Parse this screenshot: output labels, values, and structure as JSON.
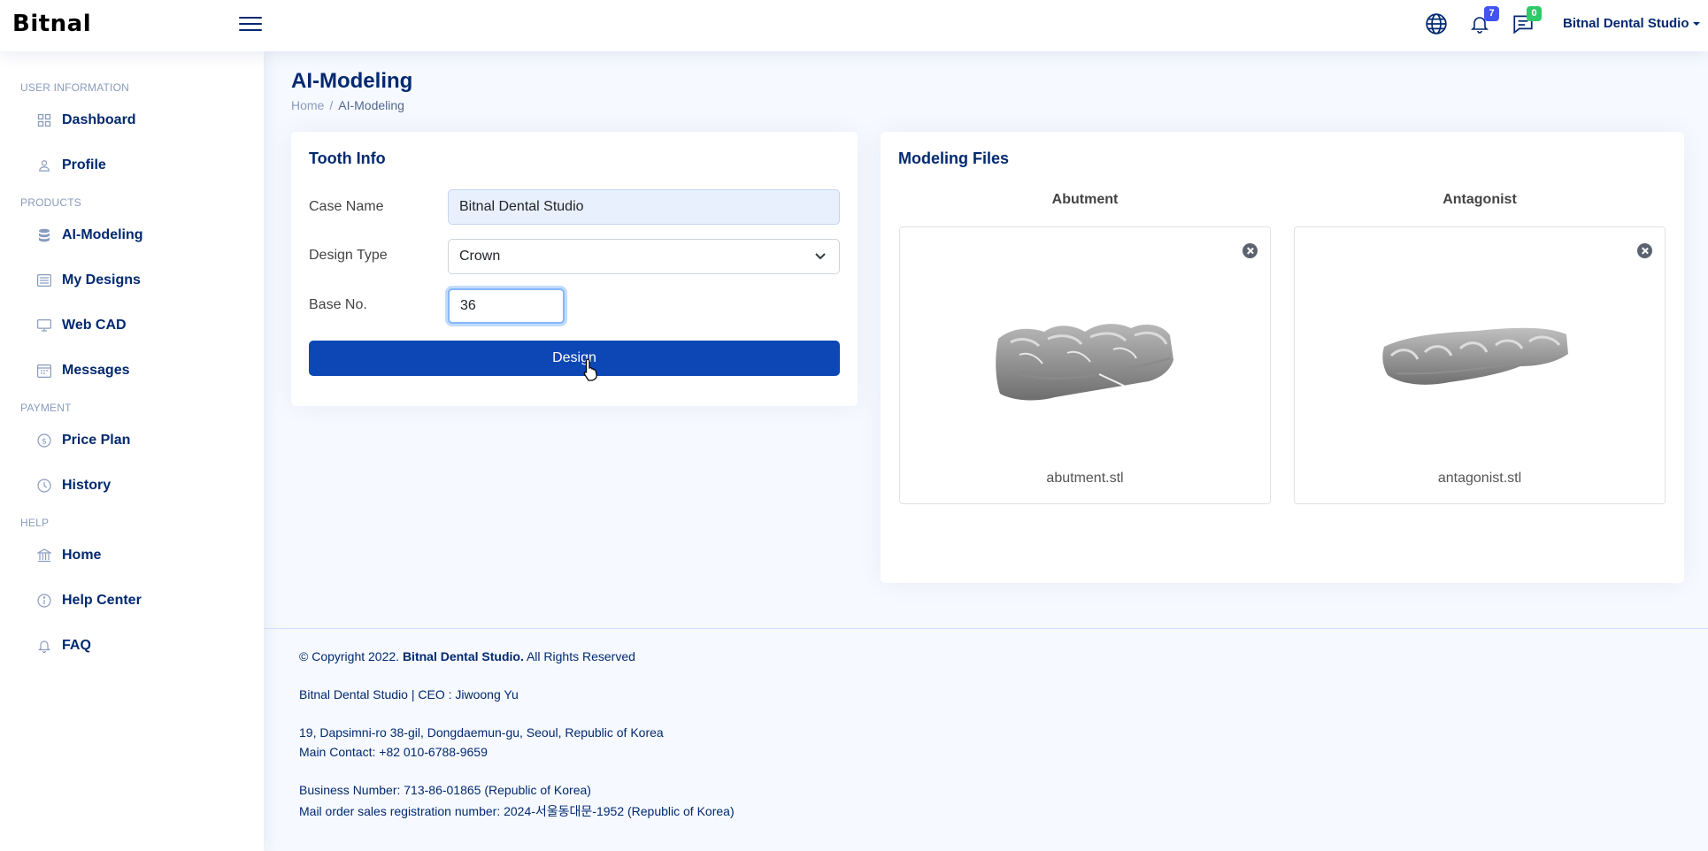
{
  "header": {
    "logo": "Bitnal",
    "notifications_count": "7",
    "messages_count": "0",
    "profile_name": "Bitnal Dental Studio"
  },
  "sidebar": {
    "sections": [
      {
        "heading": "USER INFORMATION",
        "items": [
          {
            "label": "Dashboard",
            "icon": "grid-icon"
          },
          {
            "label": "Profile",
            "icon": "person-icon"
          }
        ]
      },
      {
        "heading": "PRODUCTS",
        "items": [
          {
            "label": "AI-Modeling",
            "icon": "database-icon"
          },
          {
            "label": "My Designs",
            "icon": "list-icon"
          },
          {
            "label": "Web CAD",
            "icon": "monitor-icon"
          },
          {
            "label": "Messages",
            "icon": "calendar-icon"
          }
        ]
      },
      {
        "heading": "PAYMENT",
        "items": [
          {
            "label": "Price Plan",
            "icon": "dollar-icon"
          },
          {
            "label": "History",
            "icon": "clock-icon"
          }
        ]
      },
      {
        "heading": "HELP",
        "items": [
          {
            "label": "Home",
            "icon": "bank-icon"
          },
          {
            "label": "Help Center",
            "icon": "info-icon"
          },
          {
            "label": "FAQ",
            "icon": "bell-icon"
          }
        ]
      }
    ]
  },
  "page": {
    "title": "AI-Modeling",
    "breadcrumb": [
      "Home",
      "AI-Modeling"
    ]
  },
  "tooth_info": {
    "title": "Tooth Info",
    "case_name_label": "Case Name",
    "case_name_value": "Bitnal Dental Studio",
    "design_type_label": "Design Type",
    "design_type_value": "Crown",
    "base_no_label": "Base No.",
    "base_no_value": "36",
    "design_button": "Design"
  },
  "modeling_files": {
    "title": "Modeling Files",
    "files": [
      {
        "heading": "Abutment",
        "file_name": "abutment.stl"
      },
      {
        "heading": "Antagonist",
        "file_name": "antagonist.stl"
      }
    ]
  },
  "footer": {
    "copyright_prefix": "© Copyright 2022.",
    "copyright_company": "Bitnal Dental Studio.",
    "copyright_suffix": "All Rights Reserved",
    "ceo_line": "Bitnal Dental Studio | CEO : Jiwoong Yu",
    "address": "19, Dapsimni-ro 38-gil, Dongdaemun-gu, Seoul, Republic of Korea",
    "contact": "Main Contact: +82 010-6788-9659",
    "business_number": "Business Number: 713-86-01865 (Republic of Korea)",
    "mail_order": "Mail order sales registration number: 2024-서울동대문-1952 (Republic of Korea)"
  }
}
